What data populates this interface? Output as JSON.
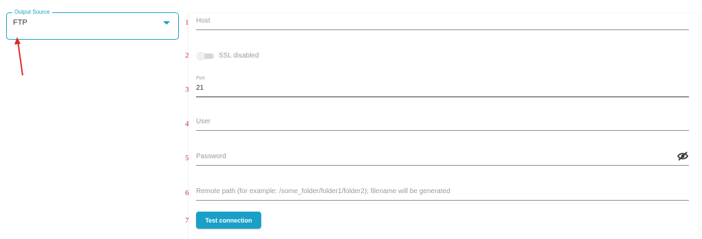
{
  "output_source": {
    "legend": "Output Source",
    "selected": "FTP",
    "accent_color": "#1aa0c8"
  },
  "markers": [
    "1",
    "2",
    "3",
    "4",
    "5",
    "6",
    "7"
  ],
  "form": {
    "host_placeholder": "Host",
    "ssl_label": "SSL disabled",
    "ssl_enabled": false,
    "port_label": "Port",
    "port_value": "21",
    "user_placeholder": "User",
    "password_placeholder": "Password",
    "remote_path_placeholder": "Remote path (for example: /some_folder/folder1/folder2); filename will be generated",
    "test_button": "Test connection"
  },
  "icons": {
    "caret": "chevron-down-icon",
    "arrow": "annotation-arrow-icon",
    "visibility": "eye-off-icon"
  }
}
